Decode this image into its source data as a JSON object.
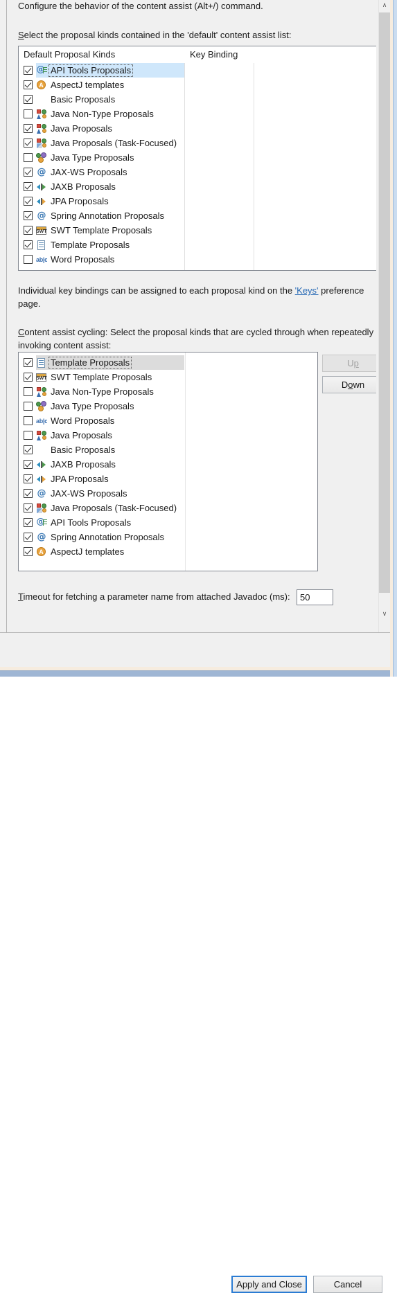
{
  "page": {
    "intro": "Configure the behavior of the content assist (Alt+/) command.",
    "default_list_label_mnemonic": "S",
    "default_list_label_rest": "elect the proposal kinds contained in the 'default' content assist list:",
    "keys_para_before": "Individual key bindings can be assigned to each proposal kind on the ",
    "keys_link": "'Keys'",
    "keys_para_after": " preference page.",
    "cycling_label_mnemonic": "C",
    "cycling_label_rest": "ontent assist cycling: Select the proposal kinds that are cycled through when repeatedly invoking content assist:"
  },
  "table1": {
    "headers": [
      "Default Proposal Kinds",
      "Key Binding"
    ],
    "rows": [
      {
        "label": "API Tools Proposals",
        "checked": true,
        "icon": "api-tools-icon",
        "selected": true
      },
      {
        "label": "AspectJ templates",
        "checked": true,
        "icon": "aspectj-icon",
        "selected": false
      },
      {
        "label": "Basic Proposals",
        "checked": true,
        "icon": "none",
        "selected": false
      },
      {
        "label": "Java Non-Type Proposals",
        "checked": false,
        "icon": "java-proposals-icon",
        "selected": false
      },
      {
        "label": "Java Proposals",
        "checked": true,
        "icon": "java-proposals-icon",
        "selected": false
      },
      {
        "label": "Java Proposals (Task-Focused)",
        "checked": true,
        "icon": "java-task-focused-icon",
        "selected": false
      },
      {
        "label": "Java Type Proposals",
        "checked": false,
        "icon": "java-type-icon",
        "selected": false
      },
      {
        "label": "JAX-WS Proposals",
        "checked": true,
        "icon": "at-sign-icon",
        "selected": false
      },
      {
        "label": "JAXB Proposals",
        "checked": true,
        "icon": "jaxb-arrows-icon",
        "selected": false
      },
      {
        "label": "JPA Proposals",
        "checked": true,
        "icon": "jpa-arrows-icon",
        "selected": false
      },
      {
        "label": "Spring Annotation Proposals",
        "checked": true,
        "icon": "at-sign-icon",
        "selected": false
      },
      {
        "label": "SWT Template Proposals",
        "checked": true,
        "icon": "swt-template-icon",
        "selected": false
      },
      {
        "label": "Template Proposals",
        "checked": true,
        "icon": "template-icon",
        "selected": false
      },
      {
        "label": "Word Proposals",
        "checked": false,
        "icon": "word-abc-icon",
        "selected": false
      }
    ]
  },
  "table2": {
    "rows": [
      {
        "label": "Template Proposals",
        "checked": true,
        "icon": "template-icon",
        "selected": true
      },
      {
        "label": "SWT Template Proposals",
        "checked": true,
        "icon": "swt-template-icon",
        "selected": false
      },
      {
        "label": "Java Non-Type Proposals",
        "checked": false,
        "icon": "java-proposals-icon",
        "selected": false
      },
      {
        "label": "Java Type Proposals",
        "checked": false,
        "icon": "java-type-icon",
        "selected": false
      },
      {
        "label": "Word Proposals",
        "checked": false,
        "icon": "word-abc-icon",
        "selected": false
      },
      {
        "label": "Java Proposals",
        "checked": false,
        "icon": "java-proposals-icon",
        "selected": false
      },
      {
        "label": "Basic Proposals",
        "checked": true,
        "icon": "none",
        "selected": false
      },
      {
        "label": "JAXB Proposals",
        "checked": true,
        "icon": "jaxb-arrows-icon",
        "selected": false
      },
      {
        "label": "JPA Proposals",
        "checked": true,
        "icon": "jpa-arrows-icon",
        "selected": false
      },
      {
        "label": "JAX-WS Proposals",
        "checked": true,
        "icon": "at-sign-icon",
        "selected": false
      },
      {
        "label": "Java Proposals (Task-Focused)",
        "checked": true,
        "icon": "java-task-focused-icon",
        "selected": false
      },
      {
        "label": "API Tools Proposals",
        "checked": true,
        "icon": "api-tools-icon",
        "selected": false
      },
      {
        "label": "Spring Annotation Proposals",
        "checked": true,
        "icon": "at-sign-icon",
        "selected": false
      },
      {
        "label": "AspectJ templates",
        "checked": true,
        "icon": "aspectj-icon",
        "selected": false
      }
    ]
  },
  "buttons": {
    "up_mnemonic_before": "U",
    "up_mnemonic": "p",
    "up_label": "Up",
    "down_before": "D",
    "down_mnemonic": "o",
    "down_after": "wn",
    "down_label": "Down",
    "apply_and_close": "Apply and Close",
    "cancel": "Cancel"
  },
  "timeout": {
    "label_mnemonic": "T",
    "label_rest": "imeout for fetching a parameter name from attached Javadoc (ms):",
    "value": "50"
  },
  "scrollbar": {
    "up_arrow": "∧",
    "down_arrow": "∨"
  },
  "colors": {
    "selection_blue": "#cfe7fb",
    "selection_grey": "#dcdcdc",
    "link": "#2a6bb5",
    "focus_border": "#2b7cd3",
    "dialog_bg": "#f0f0f0"
  }
}
